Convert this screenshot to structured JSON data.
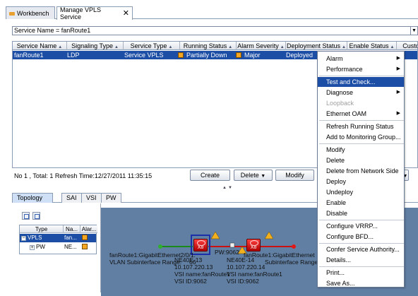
{
  "tabs": [
    {
      "label": "Workbench"
    },
    {
      "label": "Manage VPLS Service"
    }
  ],
  "filter": {
    "text": "Service Name = fanRoute1"
  },
  "table": {
    "columns": [
      "Service Name",
      "Signaling Type",
      "Service Type",
      "Running Status",
      "Alarm Severity",
      "Deployment Status",
      "Enable Status",
      "Custo"
    ],
    "rows": [
      {
        "service_name": "fanRoute1",
        "signaling_type": "LDP",
        "service_type": "Service VPLS",
        "running_status": "Partially Down",
        "alarm_severity": "Major",
        "deployment_status": "Deployed"
      }
    ]
  },
  "status": {
    "text": "No 1 , Total: 1   Refresh Time:12/27/2011 11:35:15"
  },
  "buttons": {
    "create": "Create",
    "delete": "Delete",
    "modify": "Modify"
  },
  "bottom_tabs": [
    "Topology",
    "SAI",
    "VSI",
    "PW"
  ],
  "tree": {
    "columns": [
      "Type",
      "Na...",
      "Alar..."
    ],
    "rows": [
      {
        "type": "VPLS",
        "name": "fan...",
        "expander": "−"
      },
      {
        "type": "PW",
        "name": "NE...",
        "expander": "+"
      }
    ]
  },
  "topology": {
    "left_interface": "fanRoute1:GigabitEthernet2/0/1.",
    "left_subinterface": "VLAN Subinterface Range:",
    "left_range_value": "66",
    "left_ne": "NE40E-13",
    "left_ip": "10.107.220.13",
    "left_vsi": "VSI name:fanRoute1",
    "left_vsi_id": "VSI ID:9062",
    "pw_label": "PW:9062",
    "right_ne": "NE40E-14",
    "right_ip": "10.107.220.14",
    "right_vsi": "VSI name:fanRoute1",
    "right_vsi_id": "VSI ID:9062",
    "right_interface": "fanRoute1:GigabitEthernet",
    "right_subinterface": "Subinterface Range:",
    "device_label": "X8"
  },
  "context_menu": {
    "items": [
      {
        "label": "Alarm",
        "submenu": true
      },
      {
        "label": "Performance",
        "submenu": true
      },
      {
        "label": "Test and Check...",
        "highlighted": true
      },
      {
        "label": "Diagnose",
        "submenu": true
      },
      {
        "label": "Loopback",
        "disabled": true
      },
      {
        "label": "Ethernet OAM",
        "submenu": true
      },
      {
        "label": "Refresh Running Status"
      },
      {
        "label": "Add to Monitoring Group..."
      },
      {
        "label": "Modify"
      },
      {
        "label": "Delete"
      },
      {
        "label": "Delete from Network Side"
      },
      {
        "label": "Deploy"
      },
      {
        "label": "Undeploy"
      },
      {
        "label": "Enable"
      },
      {
        "label": "Disable"
      },
      {
        "label": "Configure VRRP..."
      },
      {
        "label": "Configure BFD..."
      },
      {
        "label": "Confer Service Authority..."
      },
      {
        "label": "Details..."
      },
      {
        "label": "Print..."
      },
      {
        "label": "Save As..."
      }
    ]
  },
  "colors": {
    "selection": "#1c4ea5",
    "topology_bg": "#617fa3",
    "status_major": "#f5a623",
    "device": "#cc0000",
    "menu_highlight": "#1c4ea5"
  }
}
